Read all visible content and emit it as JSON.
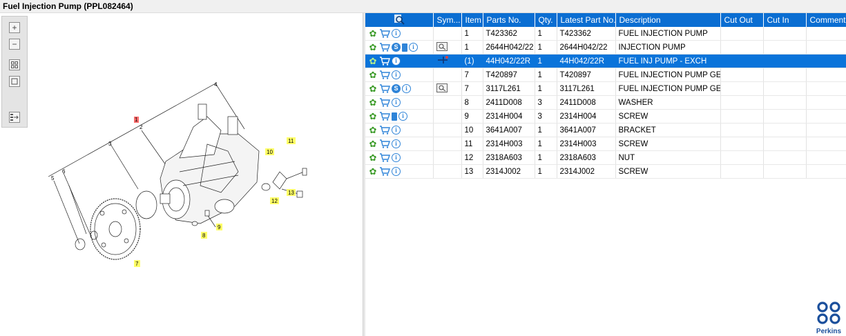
{
  "window": {
    "title": "Fuel Injection Pump (PPL082464)"
  },
  "toolbar": {
    "zoom_in": "+",
    "zoom_out": "−"
  },
  "diagram": {
    "callouts": {
      "c1": "1",
      "c2": "2",
      "c3": "3",
      "c4": "4",
      "c5": "5",
      "c6": "6",
      "c7": "7",
      "c8": "8",
      "c9": "9",
      "c10": "10",
      "c11": "11",
      "c12": "12",
      "c13": "13"
    }
  },
  "grid": {
    "columns": {
      "search": "",
      "symbol": "Sym...",
      "item": "Item",
      "parts_no": "Parts No.",
      "qty": "Qty.",
      "latest": "Latest Part No.",
      "description": "Description",
      "cut_out": "Cut Out",
      "cut_in": "Cut In",
      "comment": "Comment"
    },
    "rows": [
      {
        "item": "1",
        "parts_no": "T423362",
        "qty": "1",
        "latest": "T423362",
        "description": "FUEL INJECTION PUMP",
        "cut_out": "",
        "cut_in": "",
        "comment": ""
      },
      {
        "item": "1",
        "parts_no": "2644H042/22",
        "qty": "1",
        "latest": "2644H042/22",
        "description": "INJECTION PUMP",
        "cut_out": "",
        "cut_in": "",
        "comment": ""
      },
      {
        "item": "(1)",
        "parts_no": "44H042/22R",
        "qty": "1",
        "latest": "44H042/22R",
        "description": "FUEL INJ PUMP - EXCH",
        "cut_out": "",
        "cut_in": "",
        "comment": ""
      },
      {
        "item": "7",
        "parts_no": "T420897",
        "qty": "1",
        "latest": "T420897",
        "description": "FUEL INJECTION PUMP GEAR",
        "cut_out": "",
        "cut_in": "",
        "comment": ""
      },
      {
        "item": "7",
        "parts_no": "3117L261",
        "qty": "1",
        "latest": "3117L261",
        "description": "FUEL INJECTION PUMP GEAR",
        "cut_out": "",
        "cut_in": "",
        "comment": ""
      },
      {
        "item": "8",
        "parts_no": "2411D008",
        "qty": "3",
        "latest": "2411D008",
        "description": "WASHER",
        "cut_out": "",
        "cut_in": "",
        "comment": ""
      },
      {
        "item": "9",
        "parts_no": "2314H004",
        "qty": "3",
        "latest": "2314H004",
        "description": "SCREW",
        "cut_out": "",
        "cut_in": "",
        "comment": ""
      },
      {
        "item": "10",
        "parts_no": "3641A007",
        "qty": "1",
        "latest": "3641A007",
        "description": "BRACKET",
        "cut_out": "",
        "cut_in": "",
        "comment": ""
      },
      {
        "item": "11",
        "parts_no": "2314H003",
        "qty": "1",
        "latest": "2314H003",
        "description": "SCREW",
        "cut_out": "",
        "cut_in": "",
        "comment": ""
      },
      {
        "item": "12",
        "parts_no": "2318A603",
        "qty": "1",
        "latest": "2318A603",
        "description": "NUT",
        "cut_out": "",
        "cut_in": "",
        "comment": ""
      },
      {
        "item": "13",
        "parts_no": "2314J002",
        "qty": "1",
        "latest": "2314J002",
        "description": "SCREW",
        "cut_out": "",
        "cut_in": "",
        "comment": ""
      }
    ],
    "selected_row": 2
  },
  "brand": {
    "name": "Perkins",
    "color": "#1b4f9c"
  },
  "colors": {
    "header": "#0b6ed2",
    "selection": "#0a74da",
    "callout": "#ffff66"
  }
}
